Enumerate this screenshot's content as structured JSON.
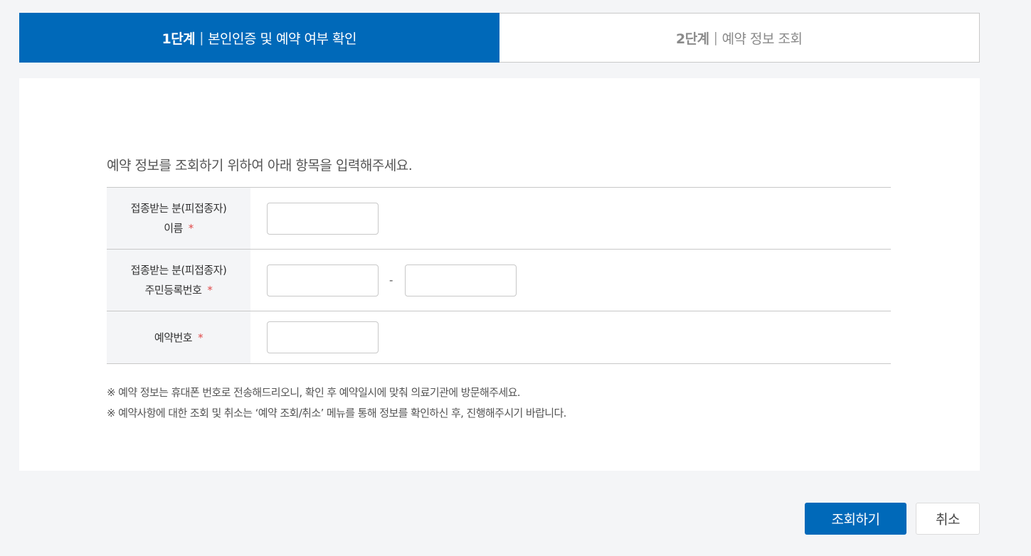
{
  "steps": [
    {
      "number": "1단계",
      "label": "본인인증 및 예약 여부 확인",
      "active": true
    },
    {
      "number": "2단계",
      "label": "예약 정보 조회",
      "active": false
    }
  ],
  "step_separator": "|",
  "intro": "예약 정보를 조회하기 위하여 아래 항목을 입력해주세요.",
  "form": {
    "required_mark": "*",
    "name": {
      "label_line1": "접종받는 분(피접종자)",
      "label_line2": "이름",
      "value": ""
    },
    "rrn": {
      "label_line1": "접종받는 분(피접종자)",
      "label_line2": "주민등록번호",
      "front_value": "",
      "back_value": "",
      "separator": "-"
    },
    "reservation": {
      "label": "예약번호",
      "value": ""
    }
  },
  "notes": [
    "※ 예약 정보는 휴대폰 번호로 전송해드리오니, 확인 후 예약일시에 맞춰 의료기관에 방문해주세요.",
    "※ 예약사항에 대한 조회 및 취소는 ‘예약 조회/취소’ 메뉴를 통해 정보를 확인하신 후, 진행해주시기 바랍니다."
  ],
  "buttons": {
    "search": "조회하기",
    "cancel": "취소"
  },
  "colors": {
    "primary": "#0069b9",
    "required": "#e04a4a"
  }
}
